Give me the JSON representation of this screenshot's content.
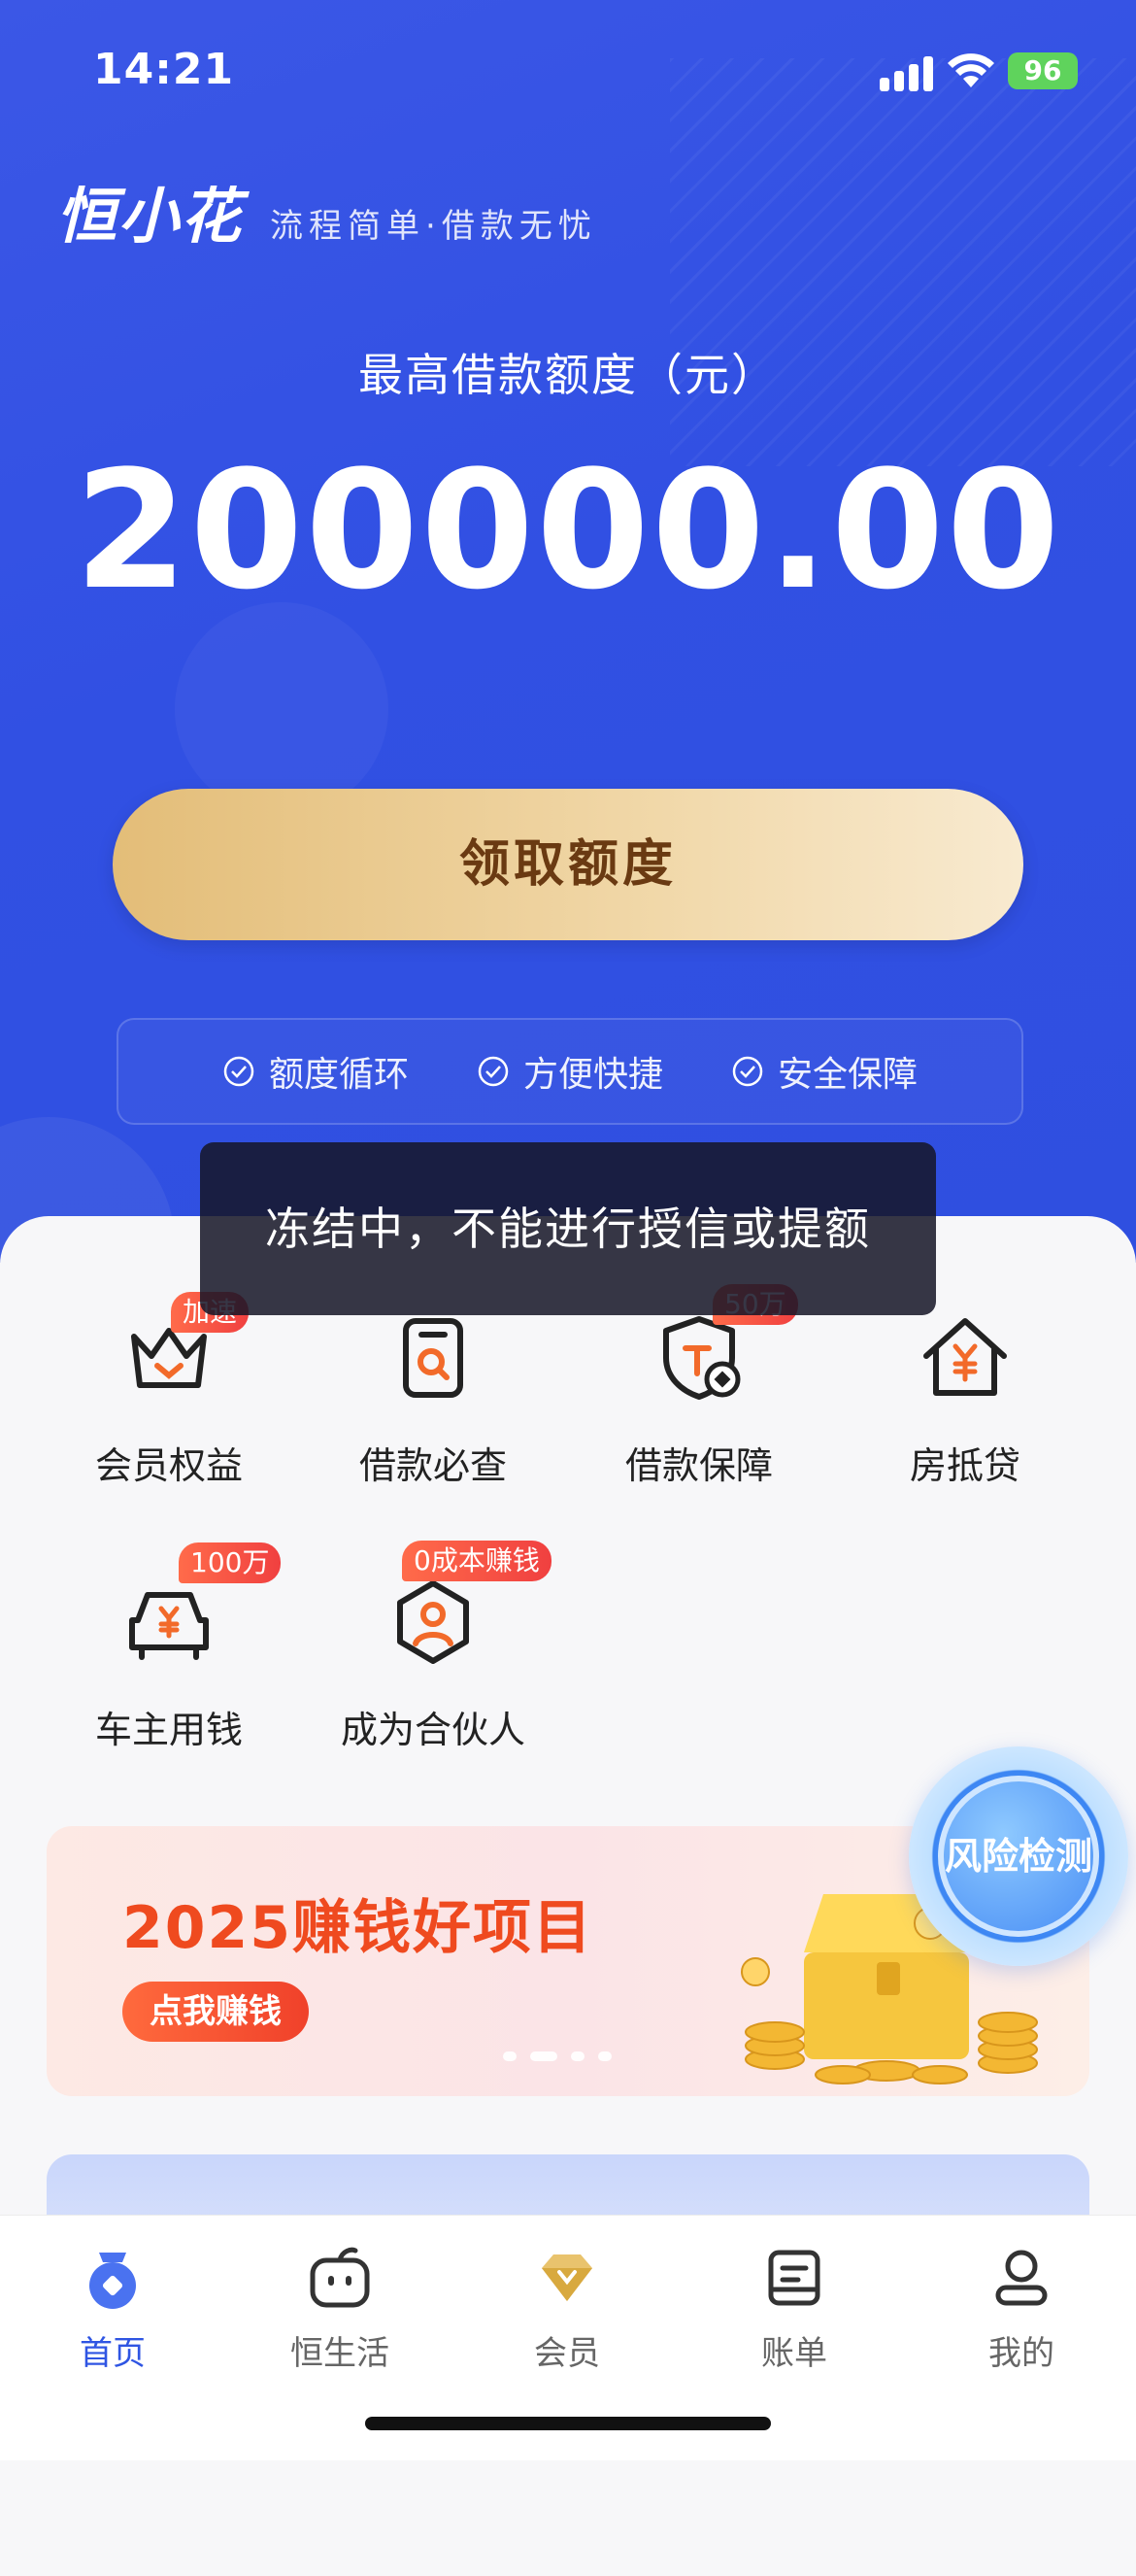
{
  "status_bar": {
    "time": "14:21",
    "battery": "96"
  },
  "brand": {
    "logo": "恒小花",
    "slogan": "流程简单·借款无忧"
  },
  "credit": {
    "label": "最高借款额度（元）",
    "amount": "200000.00"
  },
  "claim_button": "领取额度",
  "features": [
    "额度循环",
    "方便快捷",
    "安全保障"
  ],
  "toast": "冻结中，不能进行授信或提额",
  "services": [
    {
      "label": "会员权益",
      "tag": "加速",
      "icon": "crown-icon"
    },
    {
      "label": "借款必查",
      "tag": "",
      "icon": "search-document-icon"
    },
    {
      "label": "借款保障",
      "tag": "50万",
      "icon": "shield-icon"
    },
    {
      "label": "房抵贷",
      "tag": "",
      "icon": "house-icon"
    },
    {
      "label": "车主用钱",
      "tag": "100万",
      "icon": "car-icon"
    },
    {
      "label": "成为合伙人",
      "tag": "0成本赚钱",
      "icon": "partner-icon"
    }
  ],
  "banner": {
    "title": "2025赚钱好项目",
    "button": "点我赚钱",
    "page_count": 4,
    "active_page": 2
  },
  "risk_check": "风险检测",
  "tabs": [
    {
      "label": "首页",
      "icon": "home-icon",
      "active": true
    },
    {
      "label": "恒生活",
      "icon": "life-icon",
      "active": false
    },
    {
      "label": "会员",
      "icon": "diamond-icon",
      "active": false
    },
    {
      "label": "账单",
      "icon": "bill-icon",
      "active": false
    },
    {
      "label": "我的",
      "icon": "profile-icon",
      "active": false
    }
  ],
  "colors": {
    "primary": "#2f55e3",
    "gold": "#e3bd78",
    "accent_red": "#ef4a1f"
  }
}
